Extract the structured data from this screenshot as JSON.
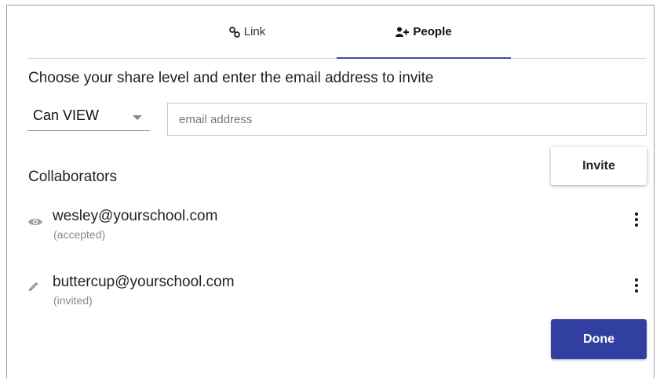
{
  "tabs": [
    {
      "label": "Link",
      "icon": "link-icon"
    },
    {
      "label": "People",
      "icon": "add-person-icon"
    }
  ],
  "active_tab": "People",
  "instruction": "Choose your share level and enter the email address to invite",
  "share_level": {
    "selected": "Can VIEW"
  },
  "email_input": {
    "placeholder": "email address",
    "value": ""
  },
  "invite_label": "Invite",
  "collaborators_heading": "Collaborators",
  "collaborators": [
    {
      "email": "wesley@yourschool.com",
      "status": "(accepted)",
      "icon": "eye-icon"
    },
    {
      "email": "buttercup@yourschool.com",
      "status": "(invited)",
      "icon": "pencil-icon"
    }
  ],
  "done_label": "Done",
  "colors": {
    "accent": "#3140a0",
    "tab_indicator": "#3f4aa8"
  }
}
